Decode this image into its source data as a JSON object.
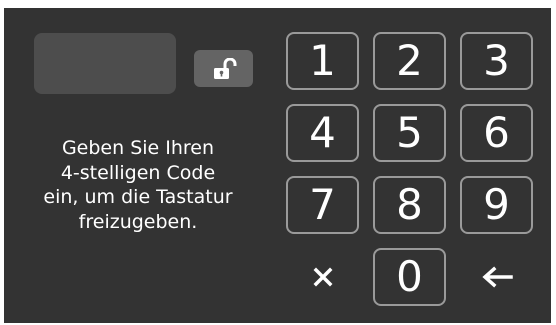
{
  "display": {
    "value": ""
  },
  "instruction": {
    "lines": [
      "Geben Sie Ihren",
      "4-stelligen Code",
      "ein, um die Tastatur",
      "freizugeben."
    ]
  },
  "keypad": {
    "keys": [
      "1",
      "2",
      "3",
      "4",
      "5",
      "6",
      "7",
      "8",
      "9",
      "0"
    ],
    "clear_icon": "close-icon",
    "backspace_icon": "arrow-left-icon"
  },
  "lock": {
    "icon": "unlock-icon",
    "state": "unlocked"
  },
  "colors": {
    "background": "#333333",
    "display": "#4d4d4d",
    "lock_button": "#646464",
    "key_border": "#9a9a9a",
    "text": "#ffffff"
  }
}
